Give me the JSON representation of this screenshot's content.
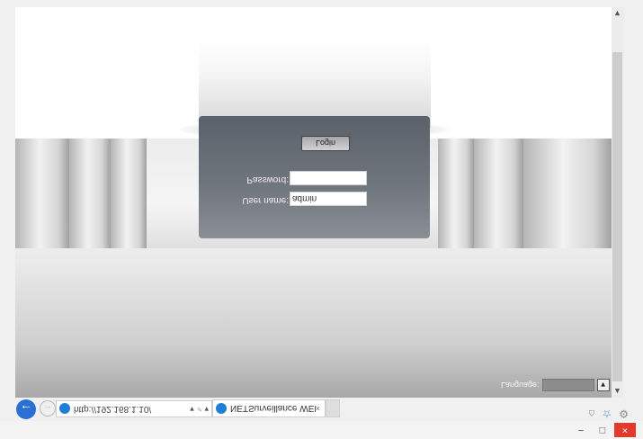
{
  "browser": {
    "address_url": "http://192.168.1.10/",
    "address_actions": "▾ ♂ ▾",
    "tab_title": "NETSurveillance WEB",
    "tab_close": "×",
    "back_symbol": "←",
    "forward_symbol": "→",
    "window_buttons": {
      "minimize": "−",
      "restore": "□",
      "close": "×"
    },
    "toolbar_icons": [
      "home-icon",
      "star-icon",
      "gear-icon"
    ]
  },
  "login": {
    "username_label": "User name:",
    "username_value": "admin",
    "password_label": "Password:",
    "password_value": "",
    "login_button": "Login"
  },
  "language": {
    "label": "Language:",
    "selected": ""
  },
  "colors": {
    "panel": "#6f757d",
    "accent_blue": "#2a6fd4",
    "close_red": "#e23b2e"
  }
}
